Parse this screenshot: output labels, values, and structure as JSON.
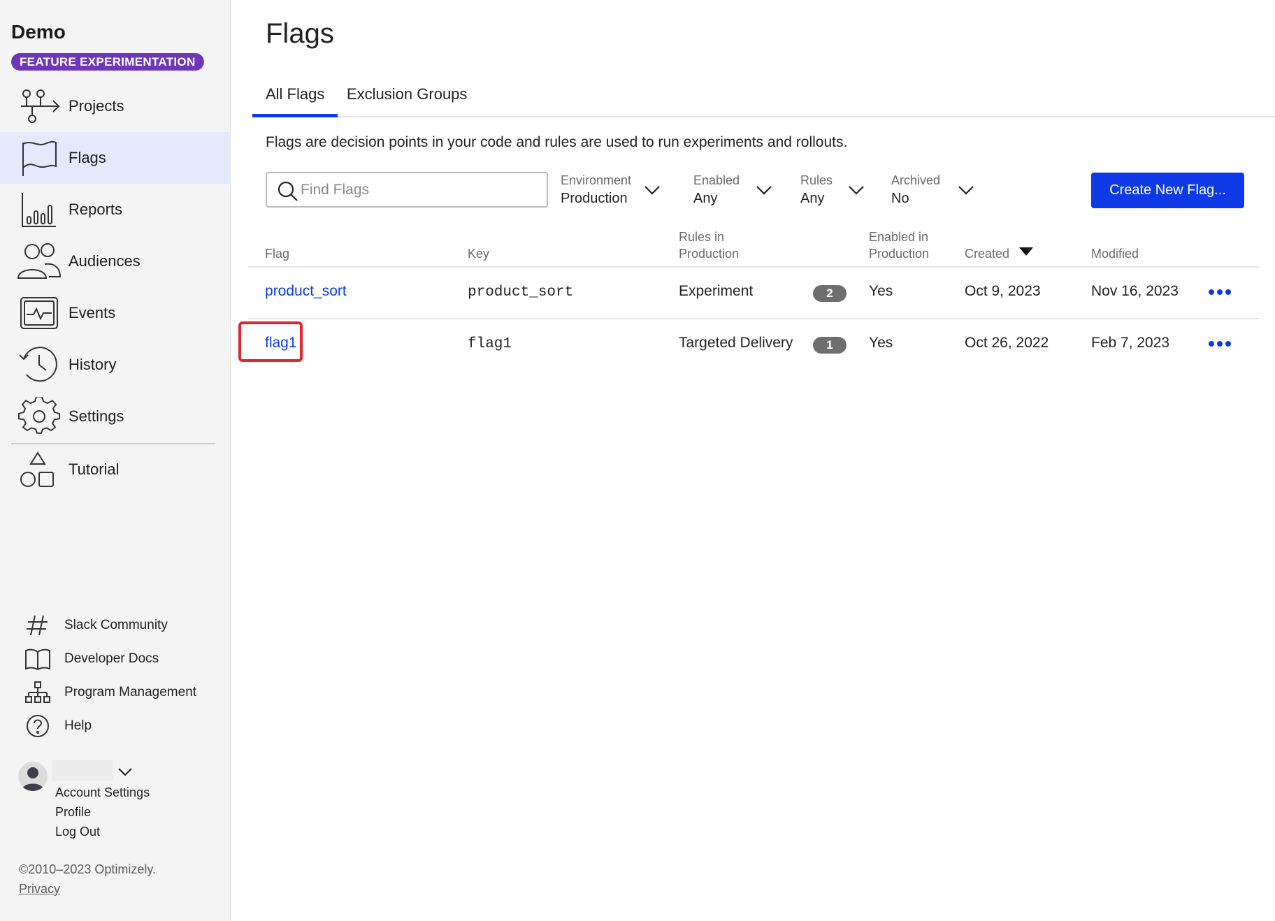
{
  "sidebar": {
    "org_name": "Demo",
    "product_badge": "FEATURE EXPERIMENTATION",
    "nav": [
      {
        "label": "Projects",
        "icon": "projects-icon"
      },
      {
        "label": "Flags",
        "icon": "flag-icon",
        "active": true
      },
      {
        "label": "Reports",
        "icon": "reports-icon"
      },
      {
        "label": "Audiences",
        "icon": "audiences-icon"
      },
      {
        "label": "Events",
        "icon": "events-icon"
      },
      {
        "label": "History",
        "icon": "history-icon"
      },
      {
        "label": "Settings",
        "icon": "gear-icon"
      },
      {
        "label": "Tutorial",
        "icon": "shapes-icon"
      }
    ],
    "resources": [
      {
        "label": "Slack Community",
        "icon": "hashtag-icon"
      },
      {
        "label": "Developer Docs",
        "icon": "book-icon"
      },
      {
        "label": "Program Management",
        "icon": "org-chart-icon"
      },
      {
        "label": "Help",
        "icon": "help-icon"
      }
    ],
    "account": {
      "links": [
        "Account Settings",
        "Profile",
        "Log Out"
      ]
    },
    "copyright": "©2010–2023 Optimizely.",
    "privacy": "Privacy"
  },
  "main": {
    "title": "Flags",
    "tabs": [
      {
        "label": "All Flags",
        "active": true
      },
      {
        "label": "Exclusion Groups",
        "active": false
      }
    ],
    "description": "Flags are decision points in your code and rules are used to run experiments and rollouts.",
    "search": {
      "placeholder": "Find Flags",
      "value": ""
    },
    "filters": [
      {
        "label": "Environment",
        "value": "Production"
      },
      {
        "label": "Enabled",
        "value": "Any"
      },
      {
        "label": "Rules",
        "value": "Any"
      },
      {
        "label": "Archived",
        "value": "No"
      }
    ],
    "create_button": "Create New Flag...",
    "table": {
      "columns": {
        "flag": "Flag",
        "key": "Key",
        "rules": [
          "Rules in",
          "Production"
        ],
        "enabled": [
          "Enabled in",
          "Production"
        ],
        "created": "Created",
        "modified": "Modified"
      },
      "sort_column": "Created",
      "rows": [
        {
          "flag": "product_sort",
          "key": "product_sort",
          "rule": "Experiment",
          "rule_count": "2",
          "enabled": "Yes",
          "created": "Oct 9, 2023",
          "modified": "Nov 16, 2023",
          "highlighted": false
        },
        {
          "flag": "flag1",
          "key": "flag1",
          "rule": "Targeted Delivery",
          "rule_count": "1",
          "enabled": "Yes",
          "created": "Oct 26, 2022",
          "modified": "Feb 7, 2023",
          "highlighted": true
        }
      ]
    }
  },
  "colors": {
    "accent": "#0d39e6",
    "badge_purple": "#6e36b8",
    "active_nav_bg": "#e6e9fb",
    "highlight_red": "#e3262d",
    "count_badge_gray": "#6e6e6e"
  }
}
